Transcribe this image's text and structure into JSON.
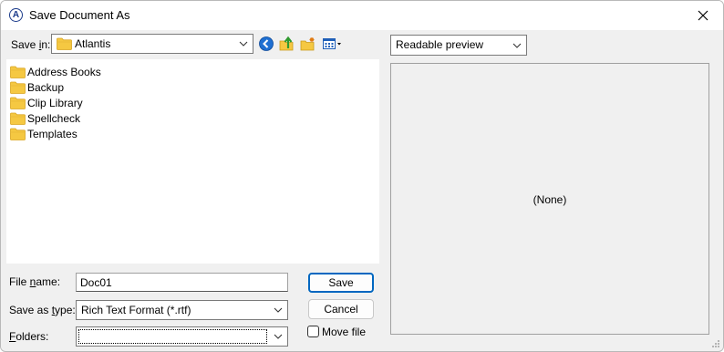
{
  "window": {
    "title": "Save Document As"
  },
  "save_in": {
    "label_prefix": "Save ",
    "label_accel": "i",
    "label_suffix": "n:",
    "value": "Atlantis"
  },
  "files": [
    {
      "name": "Address Books",
      "icon": "folder-icon"
    },
    {
      "name": "Backup",
      "icon": "folder-icon"
    },
    {
      "name": "Clip Library",
      "icon": "folder-icon"
    },
    {
      "name": "Spellcheck",
      "icon": "folder-icon"
    },
    {
      "name": "Templates",
      "icon": "folder-icon"
    }
  ],
  "filename": {
    "label_prefix": "File ",
    "label_accel": "n",
    "label_suffix": "ame:",
    "value": "Doc01"
  },
  "save_type": {
    "label_prefix": "Save as ",
    "label_accel": "t",
    "label_suffix": "ype:",
    "value": "Rich Text Format (*.rtf)"
  },
  "folders": {
    "label_accel": "F",
    "label_suffix": "olders:",
    "value": ""
  },
  "buttons": {
    "save": "Save",
    "cancel": "Cancel"
  },
  "move_file": {
    "label": "Move file",
    "checked": false
  },
  "preview": {
    "mode": "Readable preview",
    "content": "(None)"
  },
  "colors": {
    "accent": "#0067c0",
    "folder": "#f5c842",
    "nav_blue": "#1f6fd1"
  }
}
